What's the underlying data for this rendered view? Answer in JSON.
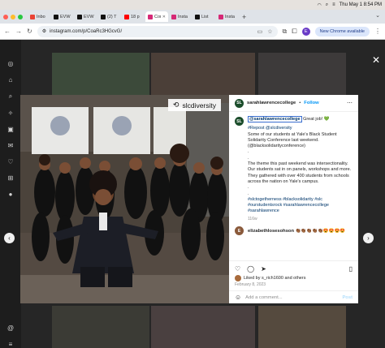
{
  "menubar": {
    "datetime": "Thu May 1  8:54 PM"
  },
  "tabs": [
    {
      "label": "Inbo",
      "color": "#ea4335"
    },
    {
      "label": "EVW",
      "color": "#111111"
    },
    {
      "label": "EVW",
      "color": "#111111"
    },
    {
      "label": "(2) T",
      "color": "#111111"
    },
    {
      "label": "18 p",
      "color": "#ff0000"
    },
    {
      "label": "Com",
      "color": "#d62976"
    },
    {
      "label": "Insta",
      "color": "#d62976"
    },
    {
      "label": "List",
      "color": "#111111"
    },
    {
      "label": "Insta",
      "color": "#d62976"
    }
  ],
  "active_tab_index": 5,
  "toolbar": {
    "url": "instagram.com/p/CoaRc3HGcvG/",
    "profile_initial": "E",
    "update_label": "New Chrome available"
  },
  "photo": {
    "watermark": "slcdiversity"
  },
  "post": {
    "username": "sarahlawrencecollege",
    "follow_label": "Follow",
    "caption": {
      "mention": "@sarahlawrencecollege",
      "greeting": " Great job! 💚",
      "repost": "#Repost @slcdiversity",
      "line1": "Some of our students at Yale's Black Student Solidarity Conference last weekend. (@blacksolidarityconference)",
      "theme": "The theme this past weekend was intersectionality. Our students sat in on panels, workshops and more. They gathered with over 400 students from schools across the nation on Yale's campus.",
      "hashtags": "#slctogetherness #blacksolidarity #slc #ourstudentsrock #sarahlawrencecollege #sarahlawrence",
      "age": "116w"
    },
    "comment2": {
      "username": "elizabethlosesohson",
      "text": "👏🏾👏🏾👏🏾👏🏾👏🏾😍😍😍😍"
    },
    "liked_by": "Liked by s_rich1600 and others",
    "date": "February 8, 2023",
    "add_comment_placeholder": "Add a comment...",
    "post_button": "Post"
  }
}
